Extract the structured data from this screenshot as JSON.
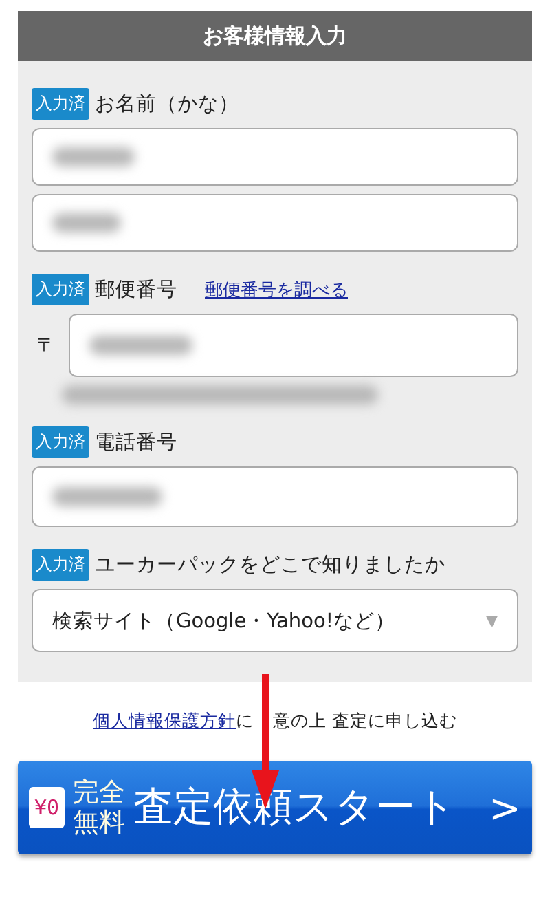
{
  "header": {
    "title": "お客様情報入力"
  },
  "fields": [
    {
      "kind": "double-text",
      "badge": "入力済",
      "label": "お名前（かな）"
    },
    {
      "kind": "postal",
      "badge": "入力済",
      "label": "郵便番号",
      "link": "郵便番号を調べる",
      "prefix": "〒"
    },
    {
      "kind": "text",
      "badge": "入力済",
      "label": "電話番号"
    },
    {
      "kind": "select",
      "badge": "入力済",
      "label": "ユーカーパックをどこで知りましたか",
      "value": "検索サイト（Google・Yahoo!など）",
      "caret": "▼"
    }
  ],
  "consent": {
    "link": "個人情報保護方針",
    "text_before_arrow": "に",
    "text_after_arrow": "意の上 査定に申し込む"
  },
  "submit": {
    "price": "¥0",
    "tag_line_1": "完全",
    "tag_line_2": "無料",
    "label": "査定依頼スタート",
    "chevron": ">"
  }
}
